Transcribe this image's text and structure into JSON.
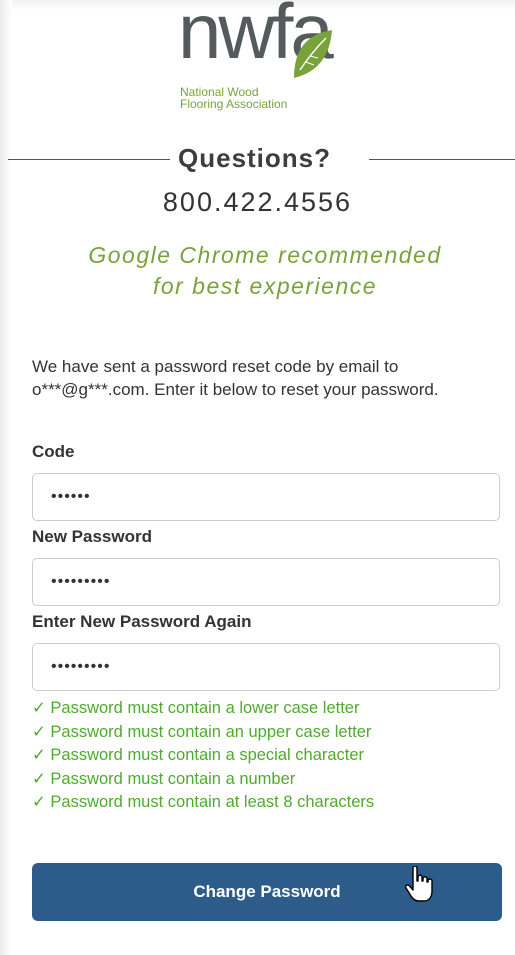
{
  "logo": {
    "wordmark": "nwfa",
    "subtitle_line1": "National Wood",
    "subtitle_line2": "Flooring Association",
    "brand_gray": "#555a5c",
    "brand_green": "#7aa23a"
  },
  "contact": {
    "heading": "Questions?",
    "phone": "800.422.4556"
  },
  "browser_note": {
    "line1": "Google Chrome recommended",
    "line2": "for best experience"
  },
  "form": {
    "intro": "We have sent a password reset code by email to o***@g***.com. Enter it below to reset your password.",
    "code_label": "Code",
    "code_value": "••••••",
    "new_password_label": "New Password",
    "new_password_value": "•••••••••",
    "confirm_password_label": "Enter New Password Again",
    "confirm_password_value": "•••••••••",
    "requirements": [
      "✓ Password must contain a lower case letter",
      "✓ Password must contain an upper case letter",
      "✓ Password must contain a special character",
      "✓ Password must contain a number",
      "✓ Password must contain at least 8 characters"
    ],
    "requirement_color": "#4eab2e",
    "submit_label": "Change Password",
    "submit_color": "#2d5c8a"
  },
  "icons": {
    "leaf": "leaf-icon",
    "cursor": "hand-pointer-icon"
  }
}
